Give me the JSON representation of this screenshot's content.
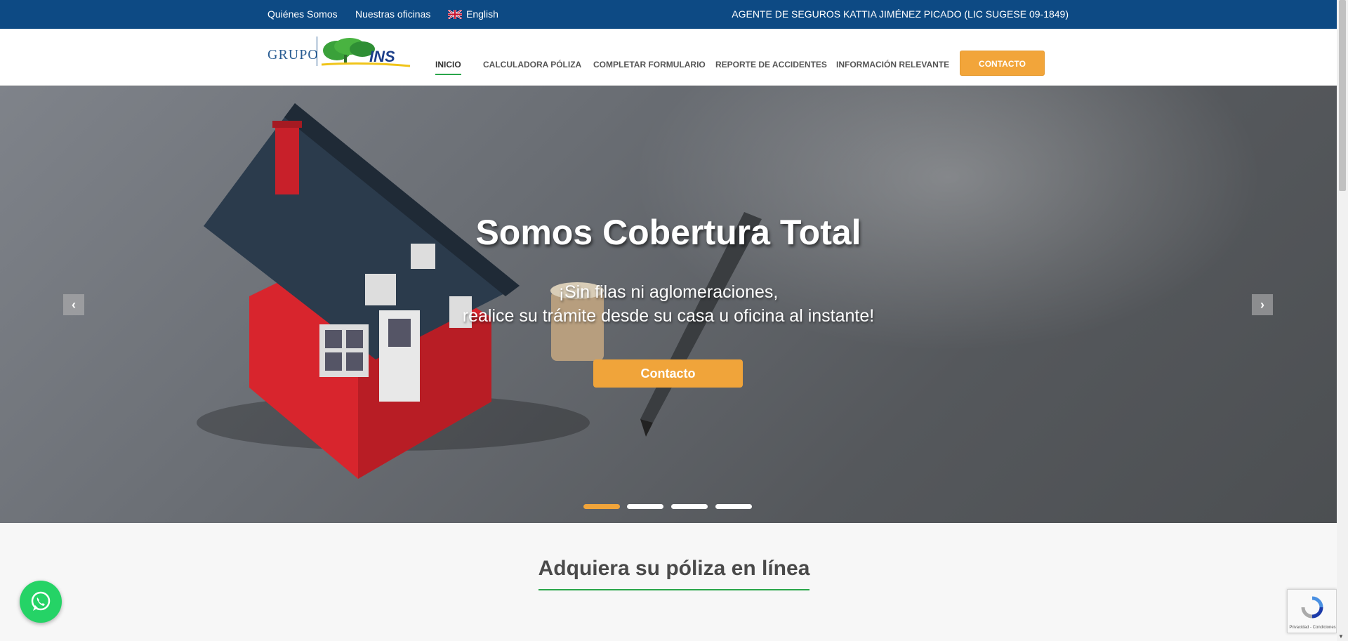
{
  "topbar": {
    "about": "Quiénes Somos",
    "offices": "Nuestras oficinas",
    "language": "English",
    "agent": "AGENTE DE SEGUROS KATTIA JIMÉNEZ PICADO (LIC SUGESE 09-1849)"
  },
  "logo": {
    "grupo": "GRUPO",
    "brand": "INS"
  },
  "nav": {
    "inicio": "INICIO",
    "calculadora": "CALCULADORA PÓLIZA",
    "formulario": "COMPLETAR FORMULARIO",
    "accidentes": "REPORTE DE ACCIDENTES",
    "informacion": "INFORMACIÓN RELEVANTE",
    "contacto": "CONTACTO"
  },
  "hero": {
    "title": "Somos Cobertura Total",
    "subtitle_line1": "¡Sin filas ni aglomeraciones,",
    "subtitle_line2": "realice su trámite desde su casa u oficina al instante!",
    "button": "Contacto",
    "active_slide": 1,
    "slide_count": 4
  },
  "section": {
    "title": "Adquiera su póliza en línea"
  },
  "recaptcha": {
    "text": "Privacidad - Condiciones"
  },
  "colors": {
    "topbar": "#0d4a84",
    "accent_orange": "#f2a53a",
    "accent_green": "#2aa64a",
    "whatsapp": "#25d366"
  },
  "icons": [
    "uk-flag-icon",
    "chevron-left-icon",
    "chevron-right-icon",
    "whatsapp-icon",
    "recaptcha-icon"
  ]
}
